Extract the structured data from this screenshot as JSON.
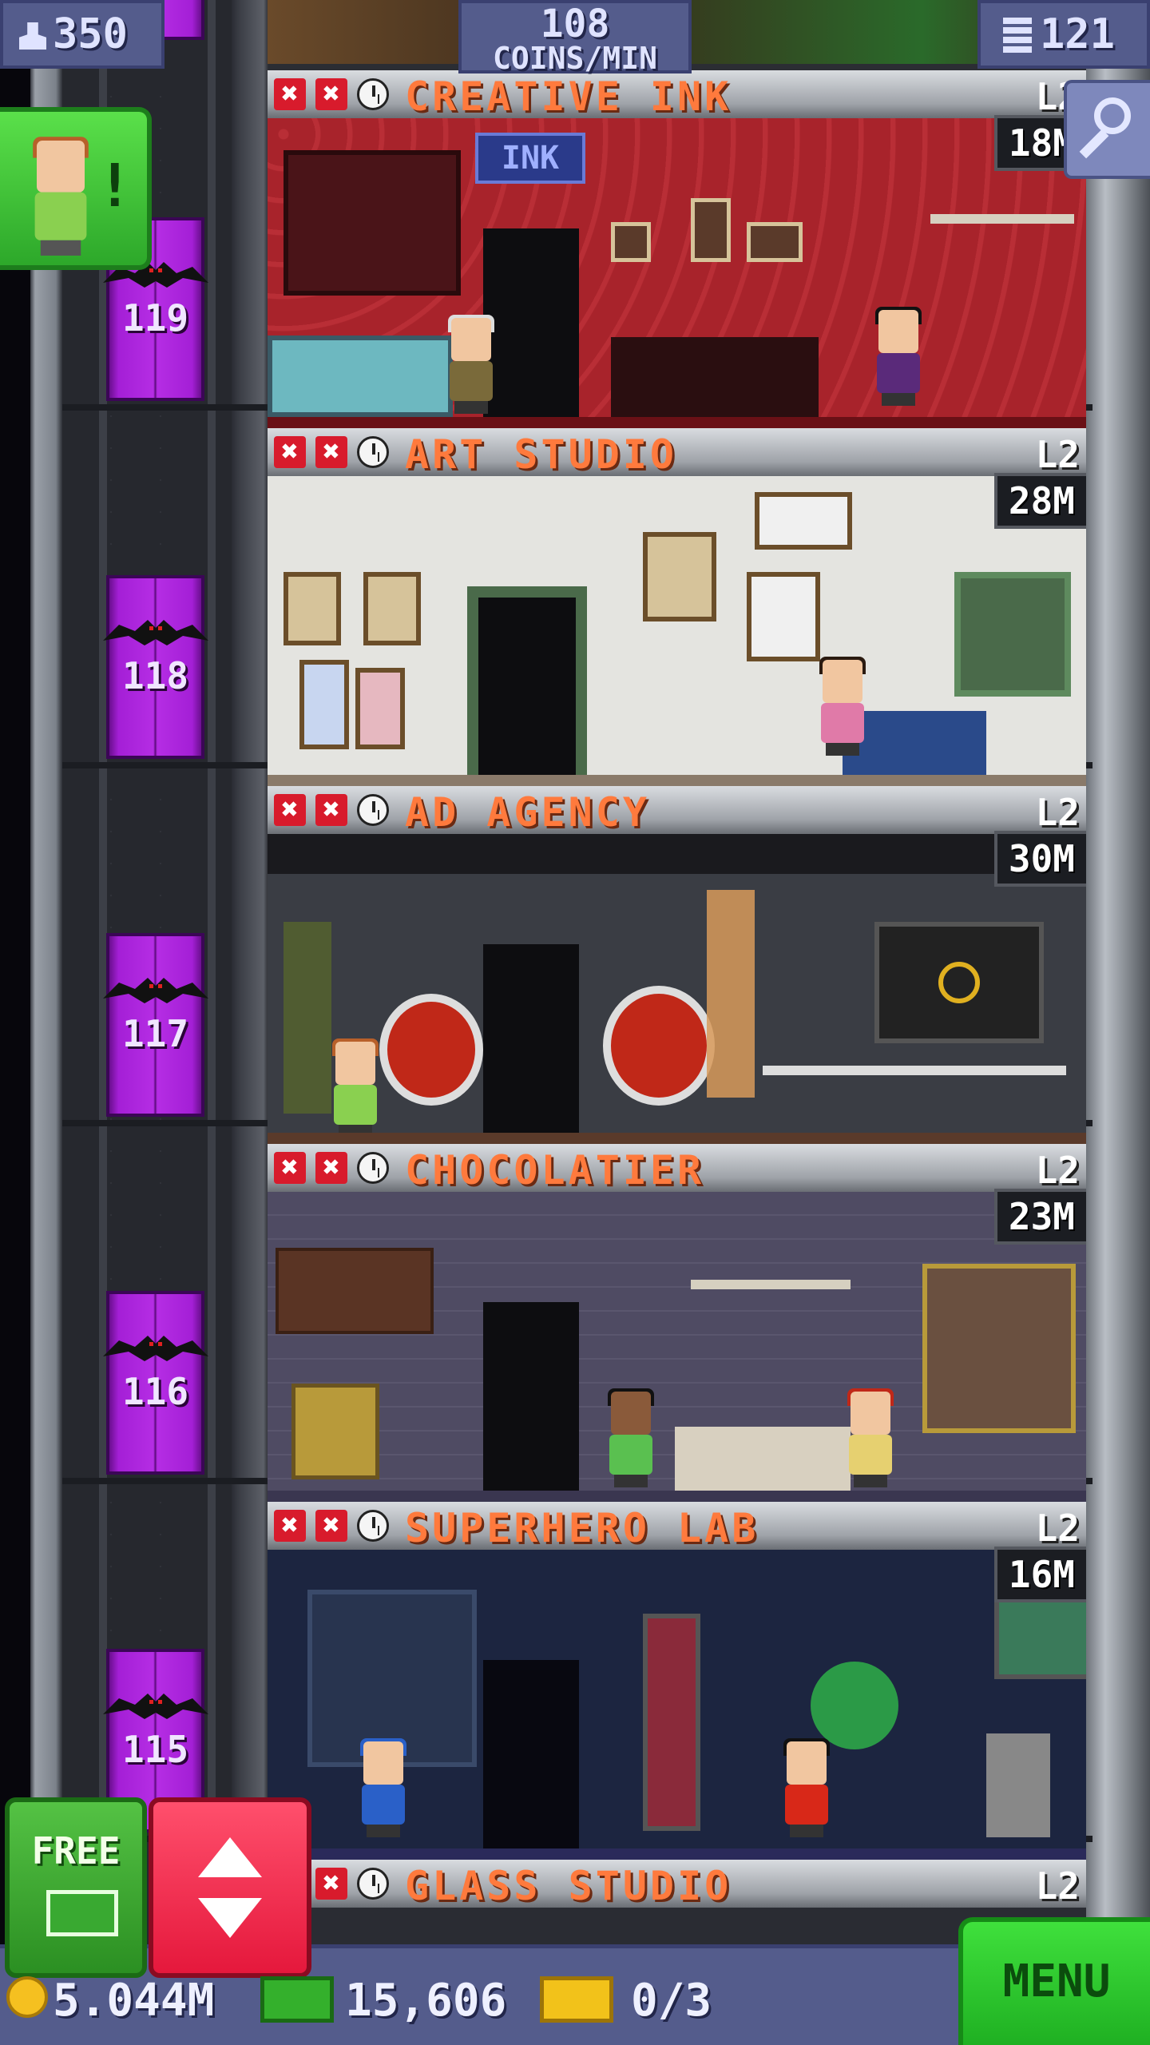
{
  "hud": {
    "population": "350",
    "coins_rate_value": "108",
    "coins_rate_unit": "COINS/MIN",
    "floors_count": "121"
  },
  "elevator": {
    "floors": [
      "119",
      "118",
      "117",
      "116",
      "115"
    ]
  },
  "floors": [
    {
      "name": "CREATIVE INK",
      "level": "L2",
      "stock": "18M",
      "wall_color": "#a8232b",
      "sign": "INK"
    },
    {
      "name": "ART STUDIO",
      "level": "L2",
      "stock": "28M",
      "wall_color": "#e4e4e0"
    },
    {
      "name": "AD AGENCY",
      "level": "L2",
      "stock": "30M",
      "wall_color": "#3a3d44"
    },
    {
      "name": "CHOCOLATIER",
      "level": "L2",
      "stock": "23M",
      "wall_color": "#4f4b63"
    },
    {
      "name": "SUPERHERO LAB",
      "level": "L2",
      "stock": "16M",
      "wall_color": "#1c2540"
    },
    {
      "name": "GLASS STUDIO",
      "level": "L2"
    }
  ],
  "bottom": {
    "free_label": "FREE",
    "coins": "5.044M",
    "bux": "15,606",
    "tickets": "0/3",
    "menu_label": "MENU"
  },
  "icons": {
    "population": "person-icon",
    "floors": "building-icon",
    "search": "magnifier-icon",
    "elevator": "up-down-arrows-icon"
  }
}
